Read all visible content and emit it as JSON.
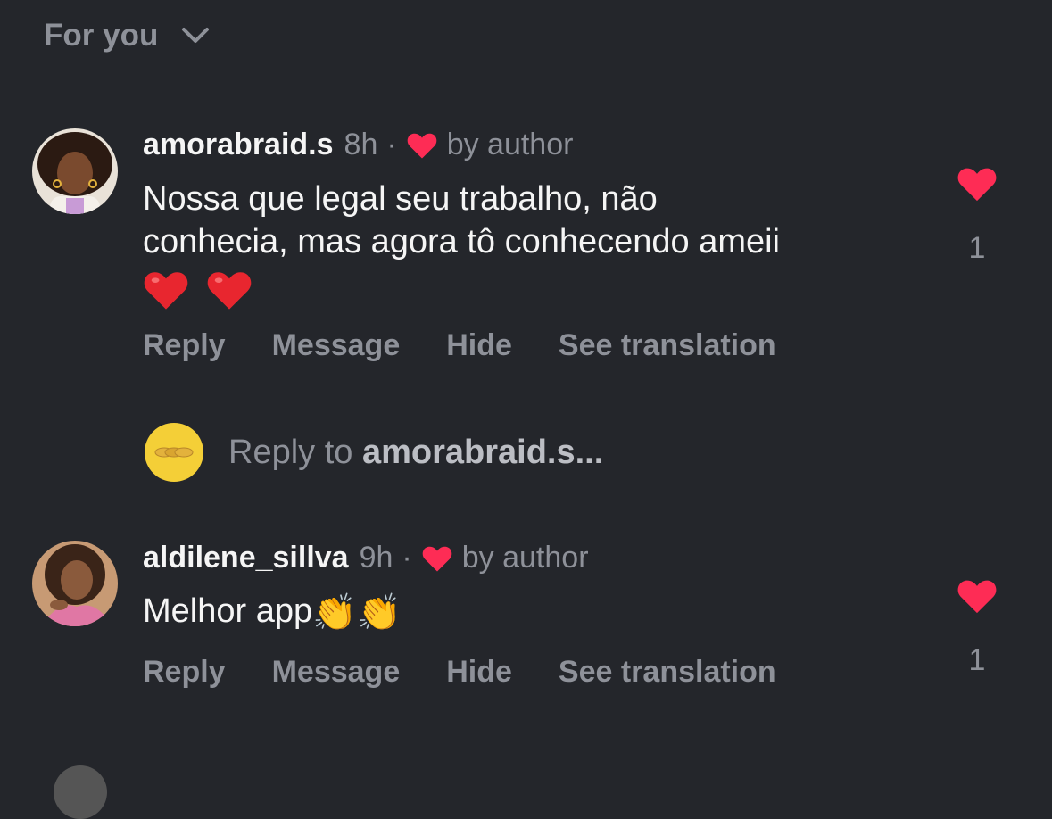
{
  "sort": {
    "label": "For you"
  },
  "comments": [
    {
      "username": "amorabraid.s",
      "time": "8h",
      "separator": "·",
      "by_author": "by author",
      "text_lines": [
        "Nossa que legal seu trabalho,  não",
        "conhecia, mas agora tô conhecendo ameii"
      ],
      "emojis": [
        "red-heart",
        "red-heart"
      ],
      "like_count": "1",
      "actions": {
        "reply": "Reply",
        "message": "Message",
        "hide": "Hide",
        "translate": "See translation"
      }
    },
    {
      "username": "aldilene_sillva",
      "time": "9h",
      "separator": "·",
      "by_author": "by author",
      "text": "Melhor app",
      "emojis": [
        "👏",
        "👏"
      ],
      "like_count": "1",
      "actions": {
        "reply": "Reply",
        "message": "Message",
        "hide": "Hide",
        "translate": "See translation"
      }
    }
  ],
  "reply_field": {
    "prefix": "Reply to ",
    "target": "amorabraid.s..."
  },
  "colors": {
    "background": "#24262b",
    "muted": "#8e9199",
    "heart": "#fe2c55",
    "reply_avatar": "#f4cf37"
  }
}
